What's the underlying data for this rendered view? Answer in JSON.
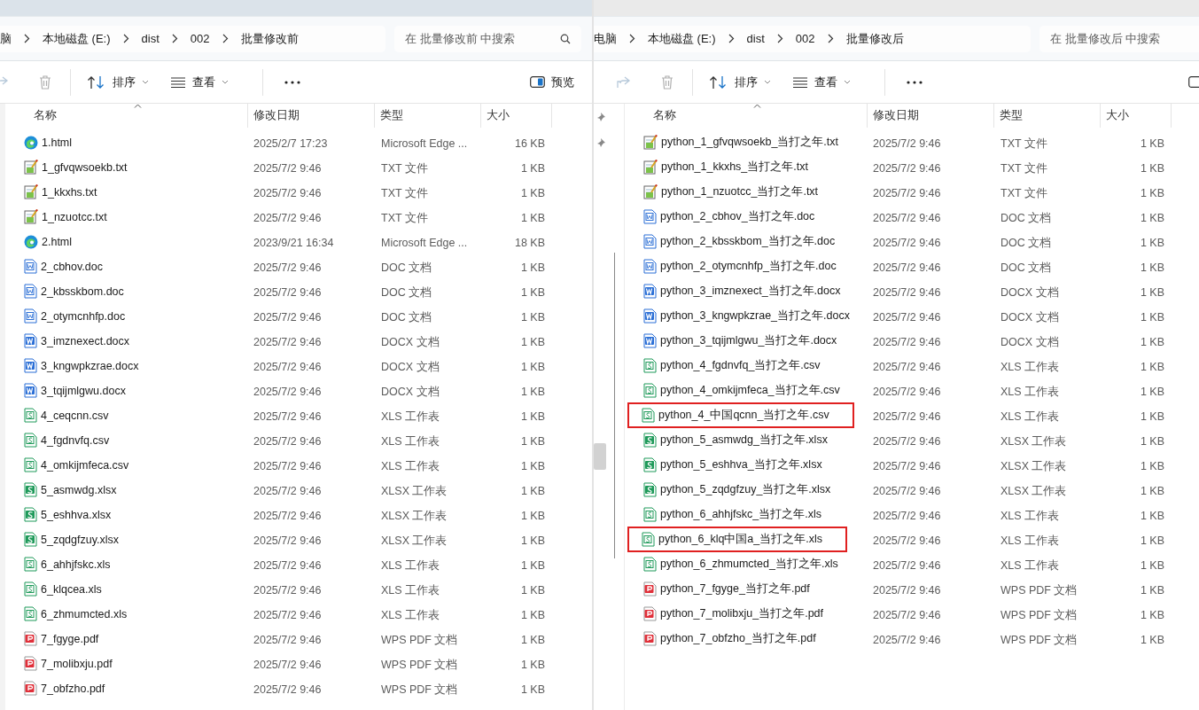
{
  "windows": [
    {
      "nav_pins": false,
      "breadcrumb": [
        "脑",
        "本地磁盘 (E:)",
        "dist",
        "002",
        "批量修改前"
      ],
      "search": {
        "placeholder": "在 批量修改前 中搜索",
        "clipped": false
      },
      "toolbar": {
        "sort": "排序",
        "view": "查看",
        "preview": "预览"
      },
      "columns": [
        "名称",
        "修改日期",
        "类型",
        "大小"
      ],
      "rows": [
        {
          "kind": "edge",
          "name": "1.html",
          "date": "2025/2/7 17:23",
          "type": "Microsoft Edge ...",
          "size": "16 KB",
          "highlighted": false
        },
        {
          "kind": "txt",
          "name": "1_gfvqwsoekb.txt",
          "date": "2025/7/2 9:46",
          "type": "TXT 文件",
          "size": "1 KB",
          "highlighted": false
        },
        {
          "kind": "txt",
          "name": "1_kkxhs.txt",
          "date": "2025/7/2 9:46",
          "type": "TXT 文件",
          "size": "1 KB",
          "highlighted": false
        },
        {
          "kind": "txt",
          "name": "1_nzuotcc.txt",
          "date": "2025/7/2 9:46",
          "type": "TXT 文件",
          "size": "1 KB",
          "highlighted": false
        },
        {
          "kind": "edge",
          "name": "2.html",
          "date": "2023/9/21 16:34",
          "type": "Microsoft Edge ...",
          "size": "18 KB",
          "highlighted": false
        },
        {
          "kind": "doc",
          "name": "2_cbhov.doc",
          "date": "2025/7/2 9:46",
          "type": "DOC 文档",
          "size": "1 KB",
          "highlighted": false
        },
        {
          "kind": "doc",
          "name": "2_kbsskbom.doc",
          "date": "2025/7/2 9:46",
          "type": "DOC 文档",
          "size": "1 KB",
          "highlighted": false
        },
        {
          "kind": "doc",
          "name": "2_otymcnhfp.doc",
          "date": "2025/7/2 9:46",
          "type": "DOC 文档",
          "size": "1 KB",
          "highlighted": false
        },
        {
          "kind": "docx",
          "name": "3_imznexect.docx",
          "date": "2025/7/2 9:46",
          "type": "DOCX 文档",
          "size": "1 KB",
          "highlighted": false
        },
        {
          "kind": "docx",
          "name": "3_kngwpkzrae.docx",
          "date": "2025/7/2 9:46",
          "type": "DOCX 文档",
          "size": "1 KB",
          "highlighted": false
        },
        {
          "kind": "docx",
          "name": "3_tqijmlgwu.docx",
          "date": "2025/7/2 9:46",
          "type": "DOCX 文档",
          "size": "1 KB",
          "highlighted": false
        },
        {
          "kind": "xls",
          "name": "4_ceqcnn.csv",
          "date": "2025/7/2 9:46",
          "type": "XLS 工作表",
          "size": "1 KB",
          "highlighted": false
        },
        {
          "kind": "xls",
          "name": "4_fgdnvfq.csv",
          "date": "2025/7/2 9:46",
          "type": "XLS 工作表",
          "size": "1 KB",
          "highlighted": false
        },
        {
          "kind": "xls",
          "name": "4_omkijmfeca.csv",
          "date": "2025/7/2 9:46",
          "type": "XLS 工作表",
          "size": "1 KB",
          "highlighted": false
        },
        {
          "kind": "xlsx",
          "name": "5_asmwdg.xlsx",
          "date": "2025/7/2 9:46",
          "type": "XLSX 工作表",
          "size": "1 KB",
          "highlighted": false
        },
        {
          "kind": "xlsx",
          "name": "5_eshhva.xlsx",
          "date": "2025/7/2 9:46",
          "type": "XLSX 工作表",
          "size": "1 KB",
          "highlighted": false
        },
        {
          "kind": "xlsx",
          "name": "5_zqdgfzuy.xlsx",
          "date": "2025/7/2 9:46",
          "type": "XLSX 工作表",
          "size": "1 KB",
          "highlighted": false
        },
        {
          "kind": "xls",
          "name": "6_ahhjfskc.xls",
          "date": "2025/7/2 9:46",
          "type": "XLS 工作表",
          "size": "1 KB",
          "highlighted": false
        },
        {
          "kind": "xls",
          "name": "6_klqcea.xls",
          "date": "2025/7/2 9:46",
          "type": "XLS 工作表",
          "size": "1 KB",
          "highlighted": false
        },
        {
          "kind": "xls",
          "name": "6_zhmumcted.xls",
          "date": "2025/7/2 9:46",
          "type": "XLS 工作表",
          "size": "1 KB",
          "highlighted": false
        },
        {
          "kind": "pdf",
          "name": "7_fgyge.pdf",
          "date": "2025/7/2 9:46",
          "type": "WPS PDF 文档",
          "size": "1 KB",
          "highlighted": false
        },
        {
          "kind": "pdf",
          "name": "7_molibxju.pdf",
          "date": "2025/7/2 9:46",
          "type": "WPS PDF 文档",
          "size": "1 KB",
          "highlighted": false
        },
        {
          "kind": "pdf",
          "name": "7_obfzho.pdf",
          "date": "2025/7/2 9:46",
          "type": "WPS PDF 文档",
          "size": "1 KB",
          "highlighted": false
        }
      ]
    },
    {
      "nav_pins": true,
      "breadcrumb": [
        "电脑",
        "本地磁盘 (E:)",
        "dist",
        "002",
        "批量修改后"
      ],
      "search": {
        "placeholder": "在 批量修改后 中搜索",
        "clipped": true
      },
      "toolbar": {
        "sort": "排序",
        "view": "查看"
      },
      "columns": [
        "名称",
        "修改日期",
        "类型",
        "大小"
      ],
      "rows": [
        {
          "kind": "txt",
          "name": "python_1_gfvqwsoekb_当打之年.txt",
          "date": "2025/7/2 9:46",
          "type": "TXT 文件",
          "size": "1 KB",
          "highlighted": false
        },
        {
          "kind": "txt",
          "name": "python_1_kkxhs_当打之年.txt",
          "date": "2025/7/2 9:46",
          "type": "TXT 文件",
          "size": "1 KB",
          "highlighted": false
        },
        {
          "kind": "txt",
          "name": "python_1_nzuotcc_当打之年.txt",
          "date": "2025/7/2 9:46",
          "type": "TXT 文件",
          "size": "1 KB",
          "highlighted": false
        },
        {
          "kind": "doc",
          "name": "python_2_cbhov_当打之年.doc",
          "date": "2025/7/2 9:46",
          "type": "DOC 文档",
          "size": "1 KB",
          "highlighted": false
        },
        {
          "kind": "doc",
          "name": "python_2_kbsskbom_当打之年.doc",
          "date": "2025/7/2 9:46",
          "type": "DOC 文档",
          "size": "1 KB",
          "highlighted": false
        },
        {
          "kind": "doc",
          "name": "python_2_otymcnhfp_当打之年.doc",
          "date": "2025/7/2 9:46",
          "type": "DOC 文档",
          "size": "1 KB",
          "highlighted": false
        },
        {
          "kind": "docx",
          "name": "python_3_imznexect_当打之年.docx",
          "date": "2025/7/2 9:46",
          "type": "DOCX 文档",
          "size": "1 KB",
          "highlighted": false
        },
        {
          "kind": "docx",
          "name": "python_3_kngwpkzrae_当打之年.docx",
          "date": "2025/7/2 9:46",
          "type": "DOCX 文档",
          "size": "1 KB",
          "highlighted": false
        },
        {
          "kind": "docx",
          "name": "python_3_tqijmlgwu_当打之年.docx",
          "date": "2025/7/2 9:46",
          "type": "DOCX 文档",
          "size": "1 KB",
          "highlighted": false
        },
        {
          "kind": "xls",
          "name": "python_4_fgdnvfq_当打之年.csv",
          "date": "2025/7/2 9:46",
          "type": "XLS 工作表",
          "size": "1 KB",
          "highlighted": false
        },
        {
          "kind": "xls",
          "name": "python_4_omkijmfeca_当打之年.csv",
          "date": "2025/7/2 9:46",
          "type": "XLS 工作表",
          "size": "1 KB",
          "highlighted": false
        },
        {
          "kind": "xls",
          "name": "python_4_中国qcnn_当打之年.csv",
          "date": "2025/7/2 9:46",
          "type": "XLS 工作表",
          "size": "1 KB",
          "highlighted": true
        },
        {
          "kind": "xlsx",
          "name": "python_5_asmwdg_当打之年.xlsx",
          "date": "2025/7/2 9:46",
          "type": "XLSX 工作表",
          "size": "1 KB",
          "highlighted": false
        },
        {
          "kind": "xlsx",
          "name": "python_5_eshhva_当打之年.xlsx",
          "date": "2025/7/2 9:46",
          "type": "XLSX 工作表",
          "size": "1 KB",
          "highlighted": false
        },
        {
          "kind": "xlsx",
          "name": "python_5_zqdgfzuy_当打之年.xlsx",
          "date": "2025/7/2 9:46",
          "type": "XLSX 工作表",
          "size": "1 KB",
          "highlighted": false
        },
        {
          "kind": "xls",
          "name": "python_6_ahhjfskc_当打之年.xls",
          "date": "2025/7/2 9:46",
          "type": "XLS 工作表",
          "size": "1 KB",
          "highlighted": false
        },
        {
          "kind": "xls",
          "name": "python_6_klq中国a_当打之年.xls",
          "date": "2025/7/2 9:46",
          "type": "XLS 工作表",
          "size": "1 KB",
          "highlighted": true
        },
        {
          "kind": "xls",
          "name": "python_6_zhmumcted_当打之年.xls",
          "date": "2025/7/2 9:46",
          "type": "XLS 工作表",
          "size": "1 KB",
          "highlighted": false
        },
        {
          "kind": "pdf",
          "name": "python_7_fgyge_当打之年.pdf",
          "date": "2025/7/2 9:46",
          "type": "WPS PDF 文档",
          "size": "1 KB",
          "highlighted": false
        },
        {
          "kind": "pdf",
          "name": "python_7_molibxju_当打之年.pdf",
          "date": "2025/7/2 9:46",
          "type": "WPS PDF 文档",
          "size": "1 KB",
          "highlighted": false
        },
        {
          "kind": "pdf",
          "name": "python_7_obfzho_当打之年.pdf",
          "date": "2025/7/2 9:46",
          "type": "WPS PDF 文档",
          "size": "1 KB",
          "highlighted": false
        }
      ]
    }
  ]
}
